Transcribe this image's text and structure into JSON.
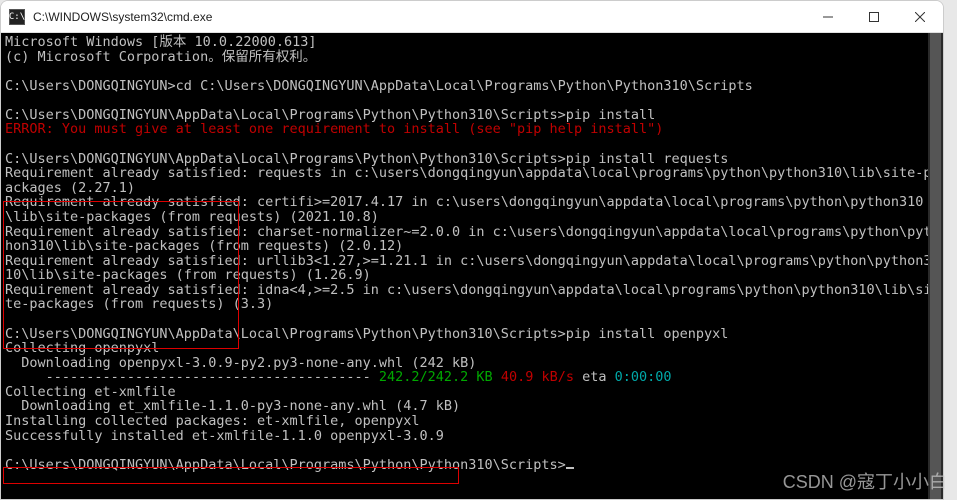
{
  "window": {
    "title": "C:\\WINDOWS\\system32\\cmd.exe",
    "icon_label": "C:\\"
  },
  "terminal": {
    "l0": "Microsoft Windows [版本 10.0.22000.613]",
    "l1": "(c) Microsoft Corporation。保留所有权利。",
    "l2": "",
    "l3": "C:\\Users\\DONGQINGYUN>cd C:\\Users\\DONGQINGYUN\\AppData\\Local\\Programs\\Python\\Python310\\Scripts",
    "l4": "",
    "l5": "C:\\Users\\DONGQINGYUN\\AppData\\Local\\Programs\\Python\\Python310\\Scripts>pip install",
    "error": "ERROR: You must give at least one requirement to install (see \"pip help install\")",
    "l7": "",
    "l8": "C:\\Users\\DONGQINGYUN\\AppData\\Local\\Programs\\Python\\Python310\\Scripts>pip install requests",
    "l9": "Requirement already satisfied: requests in c:\\users\\dongqingyun\\appdata\\local\\programs\\python\\python310\\lib\\site-packages (2.27.1)",
    "l10": "Requirement already satisfied: certifi>=2017.4.17 in c:\\users\\dongqingyun\\appdata\\local\\programs\\python\\python310\\lib\\site-packages (from requests) (2021.10.8)",
    "l11": "Requirement already satisfied: charset-normalizer~=2.0.0 in c:\\users\\dongqingyun\\appdata\\local\\programs\\python\\python310\\lib\\site-packages (from requests) (2.0.12)",
    "l12": "Requirement already satisfied: urllib3<1.27,>=1.21.1 in c:\\users\\dongqingyun\\appdata\\local\\programs\\python\\python310\\lib\\site-packages (from requests) (1.26.9)",
    "l13": "Requirement already satisfied: idna<4,>=2.5 in c:\\users\\dongqingyun\\appdata\\local\\programs\\python\\python310\\lib\\site-packages (from requests) (3.3)",
    "l14": "",
    "l15": "C:\\Users\\DONGQINGYUN\\AppData\\Local\\Programs\\Python\\Python310\\Scripts>pip install openpyxl",
    "l16": "Collecting openpyxl",
    "l17": "  Downloading openpyxl-3.0.9-py2.py3-none-any.whl (242 kB)",
    "bar": "     ---------------------------------------- ",
    "bar_done": "242.2/242.2 KB",
    "bar_rate": " 40.9 kB/s",
    "bar_eta_lbl": " eta ",
    "bar_eta": "0:00:00",
    "l19": "Collecting et-xmlfile",
    "l20": "  Downloading et_xmlfile-1.1.0-py3-none-any.whl (4.7 kB)",
    "l21": "Installing collected packages: et-xmlfile, openpyxl",
    "l22": "Successfully installed et-xmlfile-1.1.0 openpyxl-3.0.9",
    "l23": "",
    "l24": "C:\\Users\\DONGQINGYUN\\AppData\\Local\\Programs\\Python\\Python310\\Scripts>"
  },
  "watermark": "CSDN @寇丁小小白"
}
